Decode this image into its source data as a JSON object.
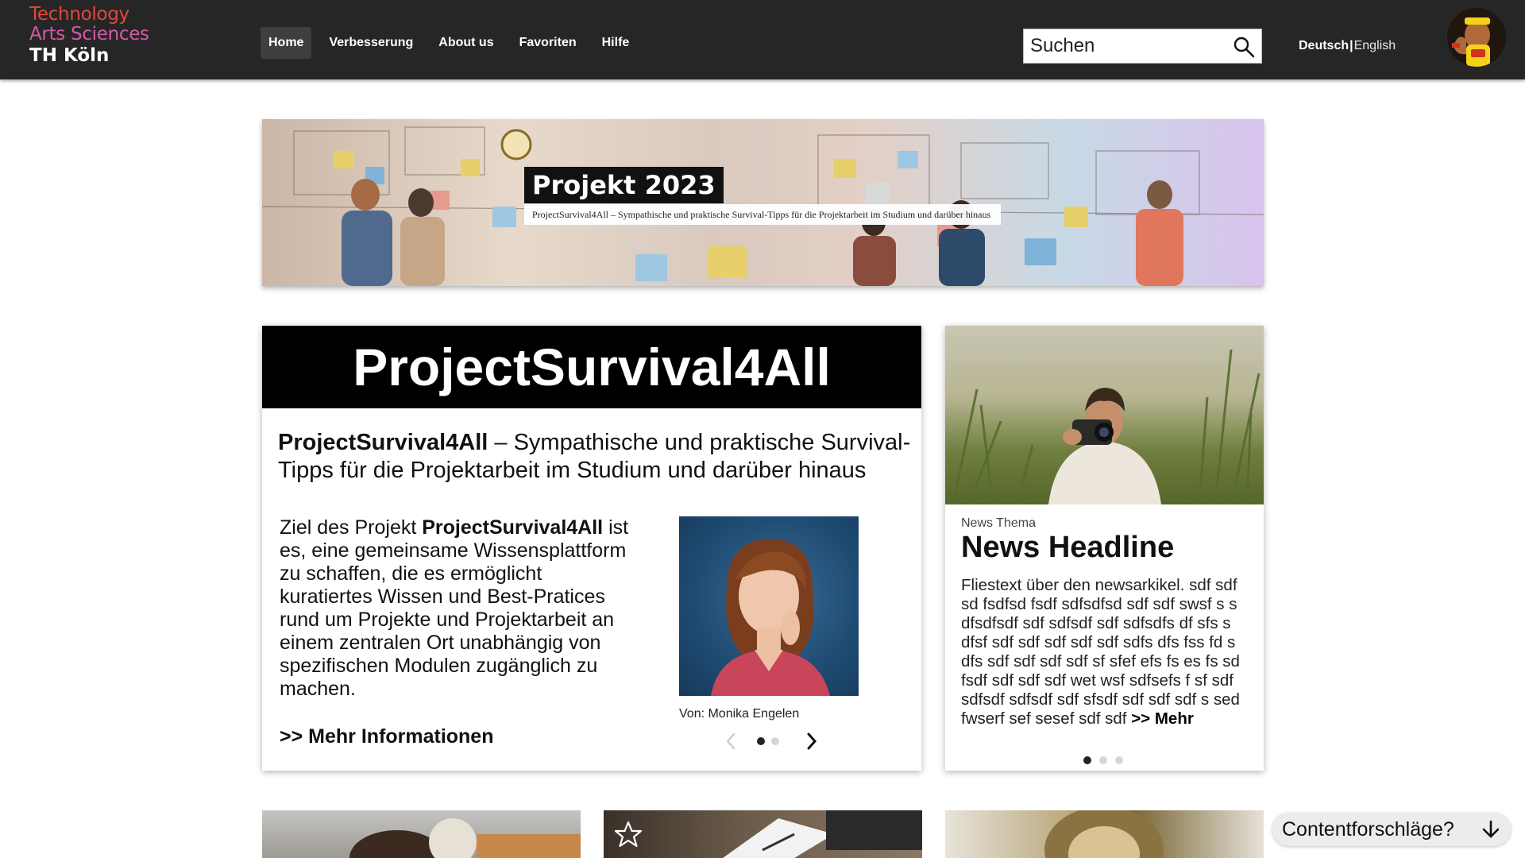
{
  "header": {
    "logo": {
      "line1": "Technology",
      "line2": "Arts Sciences",
      "line3": "TH Köln"
    },
    "nav": [
      {
        "label": "Home",
        "active": true
      },
      {
        "label": "Verbesserung",
        "active": false
      },
      {
        "label": "About us",
        "active": false
      },
      {
        "label": "Favoriten",
        "active": false
      },
      {
        "label": "Hilfe",
        "active": false
      }
    ],
    "search": {
      "placeholder": "Suchen",
      "icon": "search-icon"
    },
    "language": {
      "active": "Deutsch",
      "separator": "|",
      "other": "English"
    },
    "avatar_icon": "user-avatar"
  },
  "banner": {
    "title": "Projekt 2023",
    "subtitle": "ProjectSurvival4All – Sympathische und praktische Survival-Tipps für die Projektarbeit im Studium und darüber hinaus"
  },
  "main_card": {
    "title": "ProjectSurvival4All",
    "lead_bold": "ProjectSurvival4All",
    "lead_rest": " – Sympathische und praktische Survival-Tipps für die Projektarbeit im Studium und darüber hinaus",
    "body_pre": "Ziel des Projekt ",
    "body_bold": "ProjectSurvival4All",
    "body_post": " ist es, eine gemeinsame Wissensplattform zu schaffen, die es ermöglicht kuratiertes Wissen und Best-Pratices rund um Projekte und Projektarbeit an einem zentralen Ort unabhängig von spezifischen Modulen zugänglich zu machen.",
    "more_link": ">> Mehr Informationen",
    "author_caption": "Von: Monika Engelen",
    "carousel": {
      "slides": 2,
      "active": 1
    }
  },
  "news_card": {
    "topic": "News Thema",
    "headline": "News Headline",
    "body": "Fliestext über den newsarkikel. sdf sdf sd fsdfsd fsdf sdfsdfsd sdf sdf swsf s s dfsdfsdf sdf sdfsdf sdf sdfsdfs df sfs s dfsf sdf sdf sdf sdf sdf sdfs dfs fss fd s dfs sdf sdf sdf sdf sf sfef efs fs es fs sd fsdf sdf sdf sdf wet wsf sdfsefs f sf sdf sdfsdf sdfsdf sdf sfsdf sdf sdf sdf s sed fwserf sef sesef sdf sdf ",
    "more": ">> Mehr",
    "carousel": {
      "slides": 3,
      "active": 1
    }
  },
  "suggestions": {
    "label": "Contentforschläge?",
    "icon": "arrow-down-icon"
  },
  "colors": {
    "header_bg": "#262626",
    "logo_red": "#e0493d",
    "logo_pink": "#d45aa8",
    "accent_black": "#000000"
  }
}
